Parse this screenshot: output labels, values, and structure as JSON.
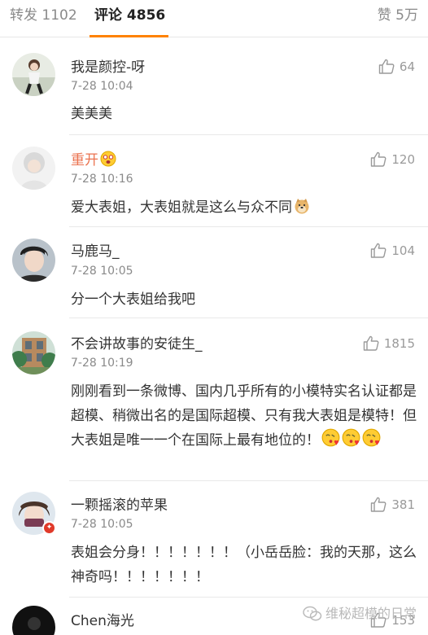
{
  "tabs": {
    "forward": "转发 1102",
    "comment": "评论 4856",
    "like": "赞 5万"
  },
  "comments": [
    {
      "user": "我是颜控-呀",
      "time": "7-28 10:04",
      "likes": "64",
      "text": "美美美"
    },
    {
      "user": "重开",
      "time": "7-28 10:16",
      "likes": "120",
      "text": "爱大表姐，大表姐就是这么与众不同"
    },
    {
      "user": "马鹿马_",
      "time": "7-28 10:05",
      "likes": "104",
      "text": "分一个大表姐给我吧"
    },
    {
      "user": "不会讲故事的安徒生_",
      "time": "7-28 10:19",
      "likes": "1815",
      "text": "刚刚看到一条微博、国内几乎所有的小模特实名认证都是超模、稍微出名的是国际超模、只有我大表姐是模特！但大表姐是唯一一个在国际上最有地位的！"
    },
    {
      "user": "一颗摇滚的苹果",
      "time": "7-28 10:05",
      "likes": "381",
      "text": "表姐会分身！！！！！！！（小岳岳脸：我的天那，这么神奇吗！！！！！！！"
    },
    {
      "user": "Chen海光",
      "likes": "153"
    }
  ],
  "watermark": "维秘超模的日常",
  "icons": {
    "like": "thumbs-up-icon",
    "watermark": "wechat-icon"
  },
  "colors": {
    "accent": "#ff8200",
    "username_highlight": "#eb7350"
  }
}
